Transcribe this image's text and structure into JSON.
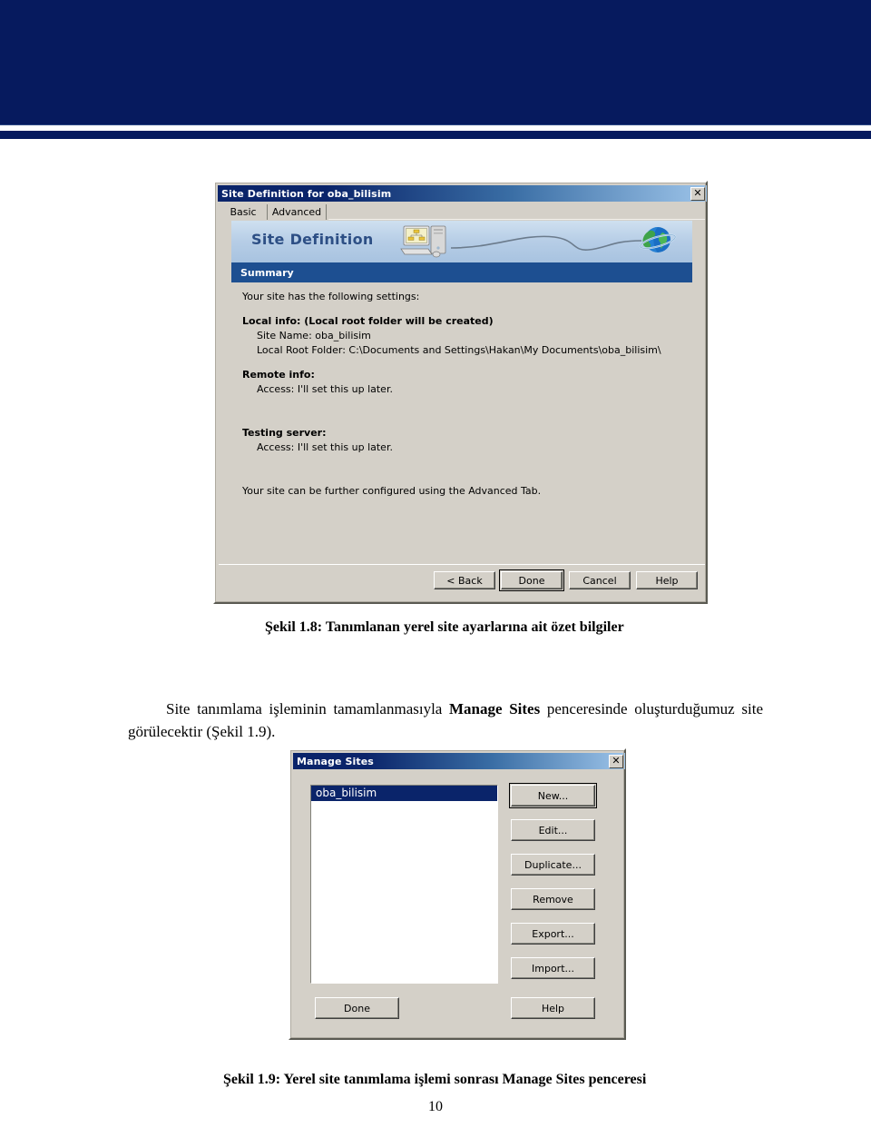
{
  "page": {
    "number": "10",
    "header_band_color": "#061a5e"
  },
  "body_text": {
    "indent_run": "Site tanımlama işleminin tamamlanmasıyla ",
    "bold_run": "Manage Sites",
    "tail_run": " penceresinde oluşturduğumuz site görülecektir (Şekil 1.9)."
  },
  "figure_1_8": {
    "caption": "Şekil 1.8: Tanımlanan yerel site ayarlarına ait özet bilgiler",
    "dialog": {
      "title": "Site Definition for oba_bilisim",
      "close_glyph": "✕",
      "tabs": [
        {
          "label": "Basic",
          "selected": true
        },
        {
          "label": "Advanced",
          "selected": false
        }
      ],
      "banner_title": "Site Definition",
      "section_header": "Summary",
      "summary": {
        "intro": "Your site has the following settings:",
        "groups": [
          {
            "heading": "Local info: (Local root folder will be created)",
            "lines": [
              "Site Name:  oba_bilisim",
              "Local Root Folder: C:\\Documents and Settings\\Hakan\\My Documents\\oba_bilisim\\"
            ]
          },
          {
            "heading": "Remote info:",
            "lines": [
              "Access: I'll set this up later."
            ]
          },
          {
            "heading": "Testing server:",
            "lines": [
              "Access: I'll set this up later."
            ]
          }
        ],
        "footnote": "Your site can be further configured using the Advanced Tab."
      },
      "buttons": [
        {
          "label": "< Back",
          "default": false
        },
        {
          "label": "Done",
          "default": true
        },
        {
          "label": "Cancel",
          "default": false
        },
        {
          "label": "Help",
          "default": false
        }
      ]
    }
  },
  "figure_1_9": {
    "caption": "Şekil 1.9: Yerel site tanımlama işlemi sonrası Manage Sites penceresi",
    "dialog": {
      "title": "Manage Sites",
      "close_glyph": "✕",
      "site_list": [
        {
          "name": "oba_bilisim",
          "selected": true
        }
      ],
      "side_buttons": [
        {
          "label": "New...",
          "default": true
        },
        {
          "label": "Edit...",
          "default": false
        },
        {
          "label": "Duplicate...",
          "default": false
        },
        {
          "label": "Remove",
          "default": false
        },
        {
          "label": "Export...",
          "default": false
        },
        {
          "label": "Import...",
          "default": false
        },
        {
          "label": "Help",
          "default": false
        }
      ],
      "done_button": "Done"
    }
  }
}
